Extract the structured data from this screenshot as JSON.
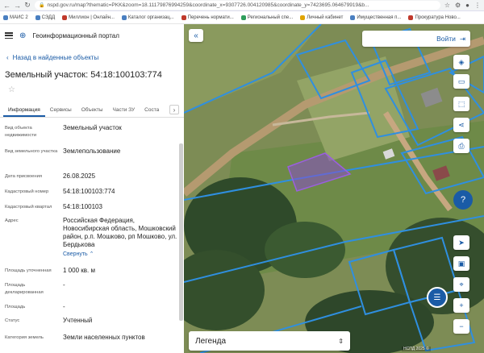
{
  "browser": {
    "url": "nspd.gov.ru/map?thematic=PKK&zoom=18.11179876994259&coordinate_x=9307726.004120985&coordinate_y=7423695.064679919&b..."
  },
  "bookmarks": [
    {
      "label": "МАИС 2"
    },
    {
      "label": "СЭДД"
    },
    {
      "label": "Миллион | Онлайн..."
    },
    {
      "label": "Каталог организац..."
    },
    {
      "label": "Перечень нормати..."
    },
    {
      "label": "Региональный спе..."
    },
    {
      "label": "Личный кабинет"
    },
    {
      "label": "Имущественная п..."
    },
    {
      "label": "Прокуратура Ново..."
    }
  ],
  "app": {
    "portal_title": "Геоинформационный портал"
  },
  "nav": {
    "back_label": "Назад в найденные объекты"
  },
  "object": {
    "title": "Земельный участок: 54:18:100103:774"
  },
  "tabs": [
    {
      "label": "Информация",
      "active": true
    },
    {
      "label": "Сервисы",
      "active": false
    },
    {
      "label": "Объекты",
      "active": false
    },
    {
      "label": "Части ЗУ",
      "active": false
    },
    {
      "label": "Соста",
      "active": false
    }
  ],
  "properties": [
    {
      "key": "Вид объекта недвижимости",
      "value": "Земельный участок"
    },
    {
      "key": "Вид земельного участка",
      "value": "Землепользование"
    },
    {
      "key": "Дата присвоения",
      "value": "26.08.2025"
    },
    {
      "key": "Кадастровый номер",
      "value": "54:18:100103:774"
    },
    {
      "key": "Кадастровый квартал",
      "value": "54:18:100103"
    },
    {
      "key": "Адрес",
      "value": "Российская Федерация, Новосибирская область, Мошковский район, р.п. Мошково, рп Мошково, ул. Бердькова"
    },
    {
      "key": "Площадь уточненная",
      "value": "1 000 кв. м"
    },
    {
      "key": "Площадь декларированная",
      "value": "-"
    },
    {
      "key": "Площадь",
      "value": "-"
    },
    {
      "key": "Статус",
      "value": "Учтенный"
    },
    {
      "key": "Категория земель",
      "value": "Земли населенных пунктов"
    }
  ],
  "address_collapse": "Свернуть",
  "map": {
    "login_label": "Войти",
    "legend_label": "Легенда",
    "attribution": "НСПД 2025 ©"
  },
  "colors": {
    "accent": "#1a5ba6",
    "boundary": "#2f8fe0",
    "parcel_fill": "#8b4fc9"
  },
  "icons": {
    "back": "chevron-left",
    "star": "star-outline",
    "collapse": "double-chevron-left",
    "login": "login-arrow",
    "layers": "layers",
    "ruler": "ruler",
    "select": "select",
    "share": "share",
    "print": "printer",
    "help": "help",
    "locate": "locate-arrow",
    "screenshot": "image",
    "pin": "pin",
    "chat": "chat",
    "zoom_in": "plus",
    "zoom_out": "minus"
  }
}
